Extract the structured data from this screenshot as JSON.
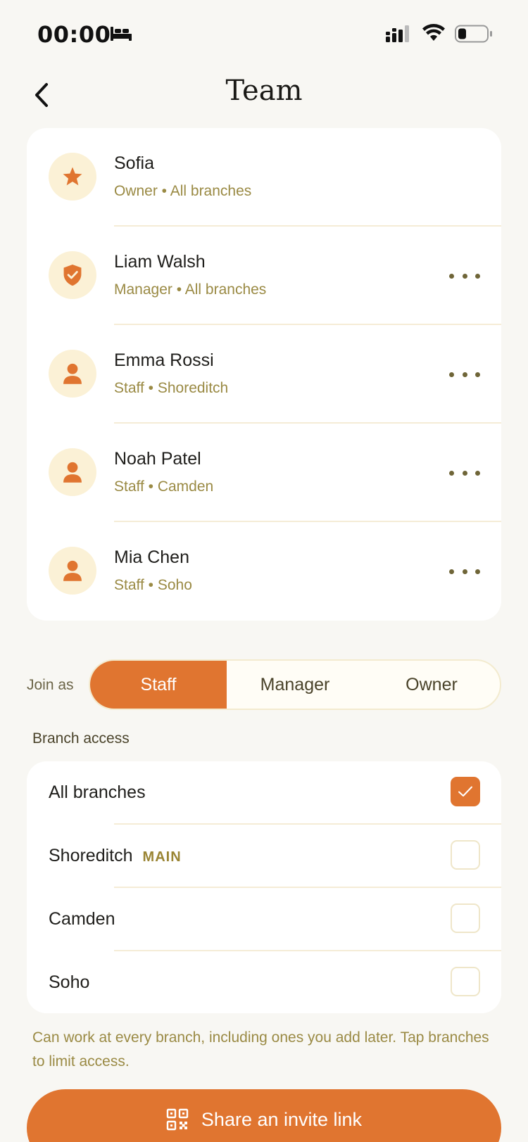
{
  "status_bar": {
    "time": "00:00"
  },
  "header": {
    "title": "Team"
  },
  "members": [
    {
      "name": "Sofia",
      "subtitle": "Owner • All branches",
      "icon": "star-icon"
    },
    {
      "name": "Liam Walsh",
      "subtitle": "Manager • All branches",
      "icon": "shield-check-icon"
    },
    {
      "name": "Emma Rossi",
      "subtitle": "Staff • Shoreditch",
      "icon": "person-icon"
    },
    {
      "name": "Noah Patel",
      "subtitle": "Staff • Camden",
      "icon": "person-icon"
    },
    {
      "name": "Mia Chen",
      "subtitle": "Staff • Soho",
      "icon": "person-icon"
    }
  ],
  "join_as": {
    "label": "Join as",
    "options": [
      "Staff",
      "Manager",
      "Owner"
    ],
    "selected": "Staff"
  },
  "branch_access": {
    "heading": "Branch access",
    "branches": [
      {
        "name": "All branches",
        "badge": "",
        "checked": true
      },
      {
        "name": "Shoreditch",
        "badge": "MAIN",
        "checked": false
      },
      {
        "name": "Camden",
        "badge": "",
        "checked": false
      },
      {
        "name": "Soho",
        "badge": "",
        "checked": false
      }
    ],
    "help": "Can work at every branch, including ones you add later. Tap branches to limit access."
  },
  "invite": {
    "label": "Share an invite link",
    "icon": "qr-code-icon"
  },
  "colors": {
    "accent": "#e07530",
    "background": "#f8f7f3",
    "muted_text": "#9a8a44"
  }
}
